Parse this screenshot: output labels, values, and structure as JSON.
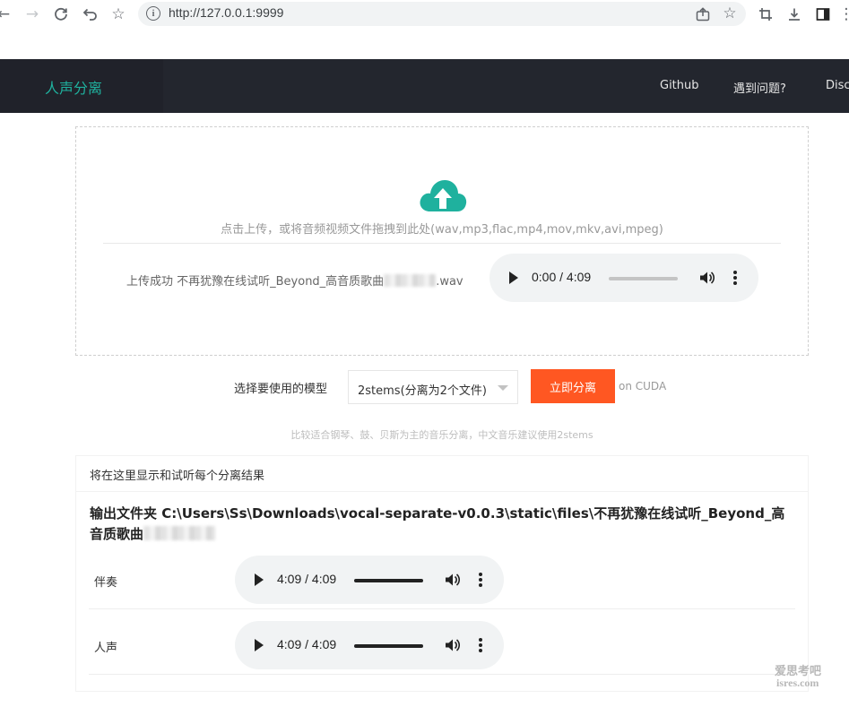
{
  "browser": {
    "url": "http://127.0.0.1:9999"
  },
  "navbar": {
    "brand": "人声分离",
    "links": [
      "Github",
      "遇到问题?",
      "Disc"
    ]
  },
  "upload": {
    "hint": "点击上传，或将音频视频文件拖拽到此处(wav,mp3,flac,mp4,mov,mkv,avi,mpeg)",
    "status_prefix": "上传成功 不再犹豫在线试听_Beyond_高音质歌曲",
    "status_suffix": ".wav",
    "player": {
      "time": "0:00 / 4:09",
      "progress": 0
    },
    "accent_color": "#1fb19e"
  },
  "model": {
    "label": "选择要使用的模型",
    "selected": "2stems(分离为2个文件)",
    "button_label": "立即分离",
    "device": "on CUDA",
    "tip": "比较适合钢琴、鼓、贝斯为主的音乐分离，中文音乐建议使用2stems",
    "button_color": "#ff5722"
  },
  "results": {
    "header": "将在这里显示和试听每个分离结果",
    "output_path": "输出文件夹 C:\\Users\\Ss\\Downloads\\vocal-separate-v0.0.3\\static\\files\\不再犹豫在线试听_Beyond_高音质歌曲",
    "tracks": [
      {
        "label": "伴奏",
        "time": "4:09 / 4:09",
        "progress": 1
      },
      {
        "label": "人声",
        "time": "4:09 / 4:09",
        "progress": 1
      }
    ]
  },
  "watermark": {
    "line1": "爱思考吧",
    "line2": "isres.com"
  }
}
